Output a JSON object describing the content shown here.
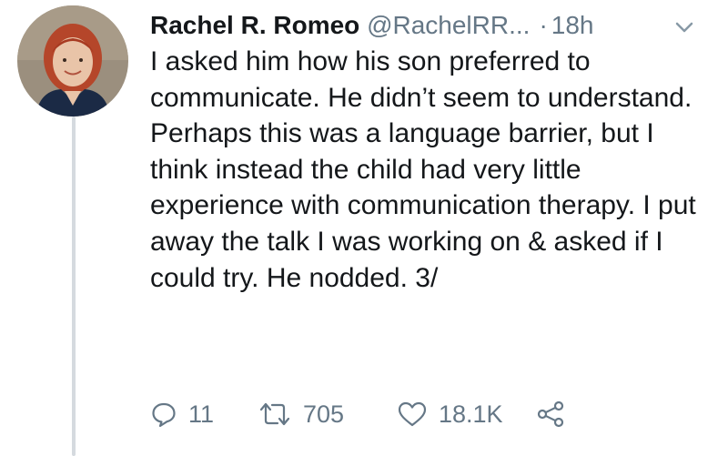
{
  "tweet": {
    "author_name": "Rachel R. Romeo",
    "handle": "@RachelRR...",
    "separator": "·",
    "time": "18h",
    "text": "I asked him how his son preferred to communicate. He didn’t seem to understand. Perhaps this was a language barrier, but I think instead the child had very little experience with communication therapy. I put away the talk I was working on & asked if I could try. He nodded. 3/",
    "actions": {
      "reply_count": "11",
      "retweet_count": "705",
      "like_count": "18.1K"
    }
  },
  "colors": {
    "text": "#14171a",
    "muted": "#657786",
    "thread_line": "#d5dadf"
  },
  "icons": [
    "avatar-photo",
    "chevron-down-icon",
    "reply-icon",
    "retweet-icon",
    "heart-icon",
    "share-icon"
  ]
}
